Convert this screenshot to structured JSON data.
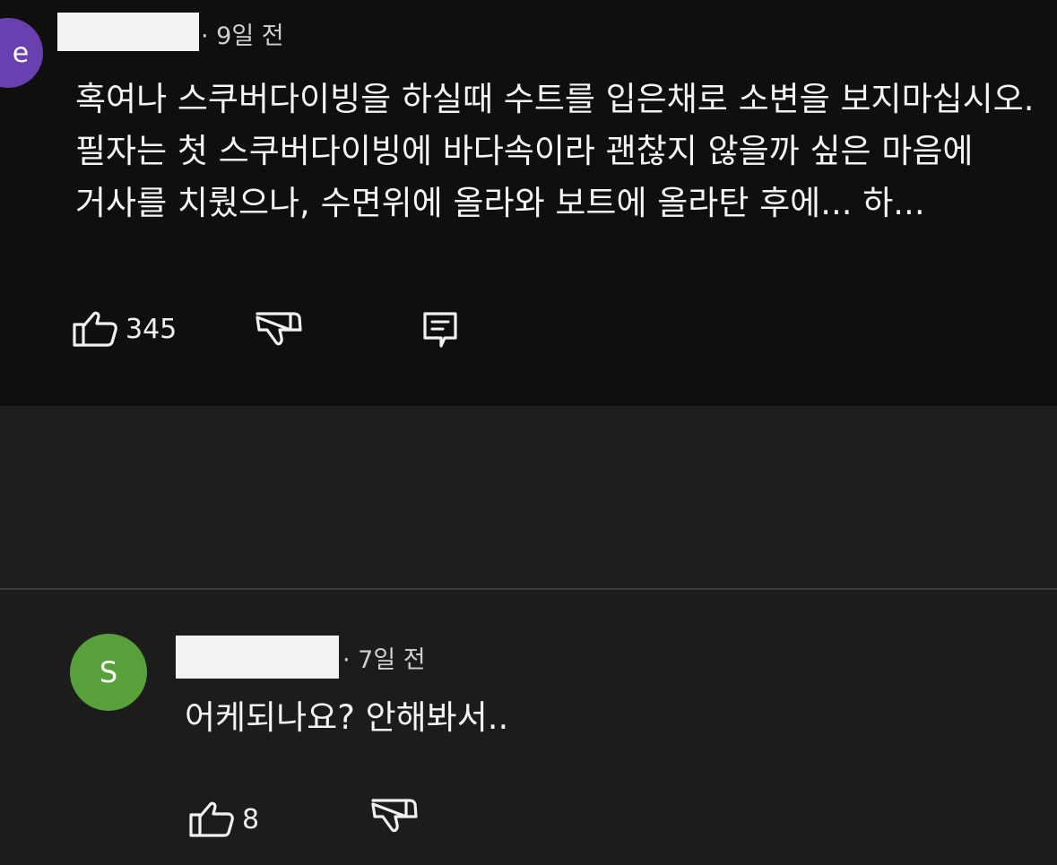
{
  "comments": [
    {
      "avatar_letter": "e",
      "avatar_color": "#6a3fb0",
      "time": "· 9일 전",
      "lines": [
        "혹여나 스쿠버다이빙을 하실때 수트를 입은채로 소변을 보지마십시오.",
        "필자는 첫 스쿠버다이빙에 바다속이라 괜찮지 않을까 싶은 마음에",
        "거사를 치뤘으나, 수면위에 올라와 보트에 올라탄 후에... 하..."
      ],
      "likes": "345",
      "icons": [
        "thumbs-up-icon",
        "thumbs-down-icon",
        "reply-icon"
      ]
    },
    {
      "avatar_letter": "S",
      "avatar_color": "#58a13a",
      "time": "· 7일 전",
      "lines": [
        "어케되나요? 안해봐서.."
      ],
      "likes": "8",
      "icons": [
        "thumbs-up-icon",
        "thumbs-down-icon"
      ]
    }
  ]
}
